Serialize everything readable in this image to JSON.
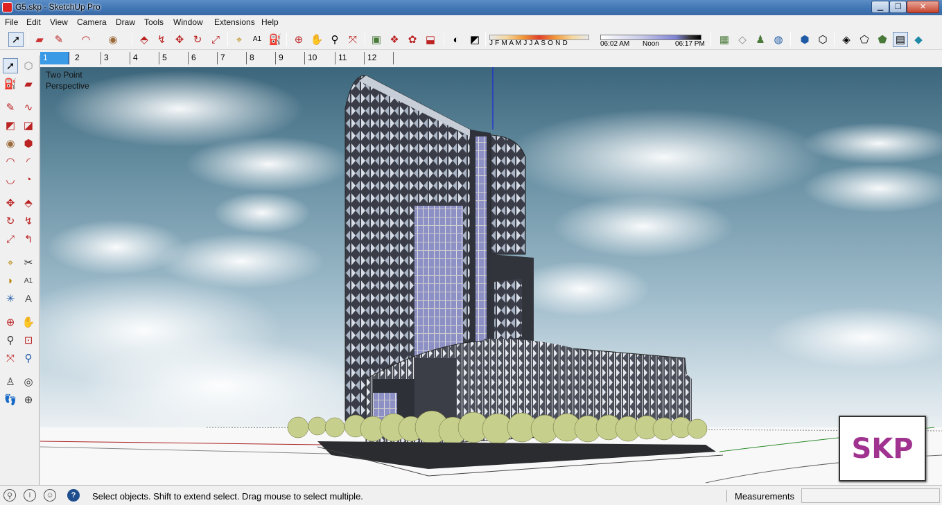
{
  "window": {
    "title": "G5.skp - SketchUp Pro",
    "app_icon": "sketchup-icon",
    "minimize": "▁",
    "maximize": "❐",
    "close": "✕"
  },
  "menu": [
    "File",
    "Edit",
    "View",
    "Camera",
    "Draw",
    "Tools",
    "Window",
    "Extensions",
    "Help"
  ],
  "toolbar": {
    "icons": [
      "select-icon",
      "eraser-icon",
      "pencil-icon",
      "arc-icon",
      "circle-icon",
      "push-pull-icon",
      "follow-me-icon",
      "move-icon",
      "rotate-icon",
      "scale-icon",
      "tape-measure-icon",
      "text-icon",
      "paint-bucket-icon",
      "orbit-icon",
      "pan-icon",
      "zoom-icon",
      "zoom-extents-icon",
      "warehouse-icon",
      "extension-warehouse-icon",
      "layout-icon",
      "share-icon",
      "shadow-toggle-icon",
      "fog-icon"
    ]
  },
  "shadow_settings": {
    "months": "J F M A M J J A S O N D",
    "time_start": "06:02 AM",
    "time_noon": "Noon",
    "time_end": "06:17 PM"
  },
  "scenes": [
    "1",
    "2",
    "3",
    "4",
    "5",
    "6",
    "7",
    "8",
    "9",
    "10",
    "11",
    "12"
  ],
  "active_scene": "1",
  "viewport": {
    "camera_label_line1": "Two Point",
    "camera_label_line2": "Perspective"
  },
  "logo": {
    "text": "SKP",
    "color": "#a0338f"
  },
  "status": {
    "message": "Select objects. Shift to extend select. Drag mouse to select multiple.",
    "measurements_label": "Measurements",
    "measurements_value": ""
  },
  "colors": {
    "selected_tab": "#3b9ae6",
    "title_bar": "#3f74b3"
  }
}
